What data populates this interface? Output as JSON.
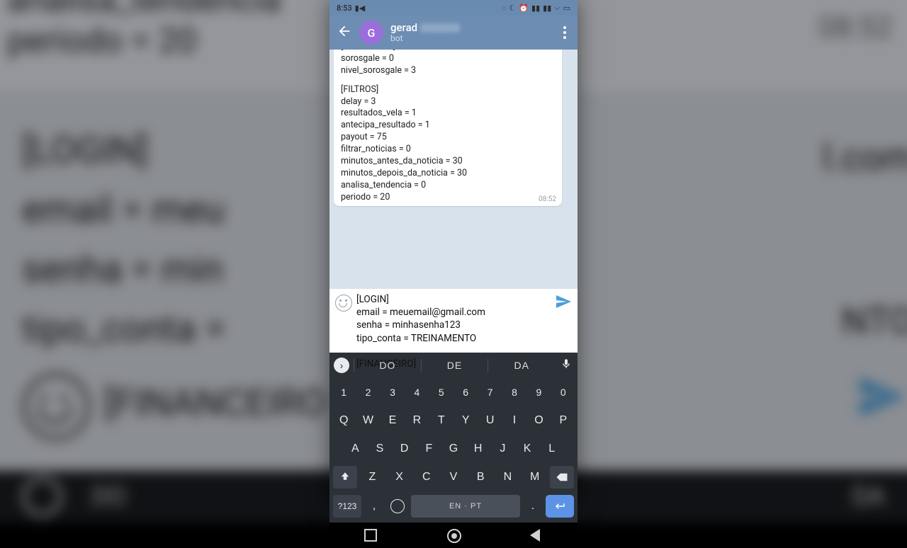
{
  "statusbar": {
    "time": "8:53"
  },
  "header": {
    "name": "gerad",
    "sub": "bot",
    "avatar": "G"
  },
  "bubble_in": {
    "lines": [
      "[SOROSGALE]",
      "sorosgale = 0",
      "nivel_sorosgale = 3",
      "",
      "[FILTROS]",
      "delay = 3",
      "resultados_vela = 1",
      "antecipa_resultado = 1",
      "payout = 75",
      "filtrar_noticias = 0",
      "minutos_antes_da_noticia = 30",
      "minutos_depois_da_noticia = 30",
      "analisa_tendencia = 0",
      "periodo = 20"
    ],
    "timestamp": "08:52"
  },
  "draft": {
    "text": "[LOGIN]\nemail = meuemail@gmail.com\nsenha = minhasenha123\ntipo_conta = TREINAMENTO\n\n[FINANCEIRO]"
  },
  "keyboard": {
    "suggestions": [
      "DO",
      "DE",
      "DA"
    ],
    "row_num": [
      "1",
      "2",
      "3",
      "4",
      "5",
      "6",
      "7",
      "8",
      "9",
      "0"
    ],
    "row1": [
      "Q",
      "W",
      "E",
      "R",
      "T",
      "Y",
      "U",
      "I",
      "O",
      "P"
    ],
    "row2": [
      "A",
      "S",
      "D",
      "F",
      "G",
      "H",
      "J",
      "K",
      "L"
    ],
    "row3": [
      "Z",
      "X",
      "C",
      "V",
      "B",
      "N",
      "M"
    ],
    "sym": "?123",
    "space": "EN · PT",
    "comma": ",",
    "period": "."
  },
  "backdrop": {
    "top_lines": "analisa_tendencia\nperiodo = 20",
    "top_time": "08:52",
    "mid": "[LOGIN]\nemail = meu\nsenha = min\ntipo_conta =",
    "email_right": "l.com",
    "nto": "NTO",
    "fin": "[FINANCEIRO",
    "kb_do": "DO",
    "kb_da": "DA"
  }
}
